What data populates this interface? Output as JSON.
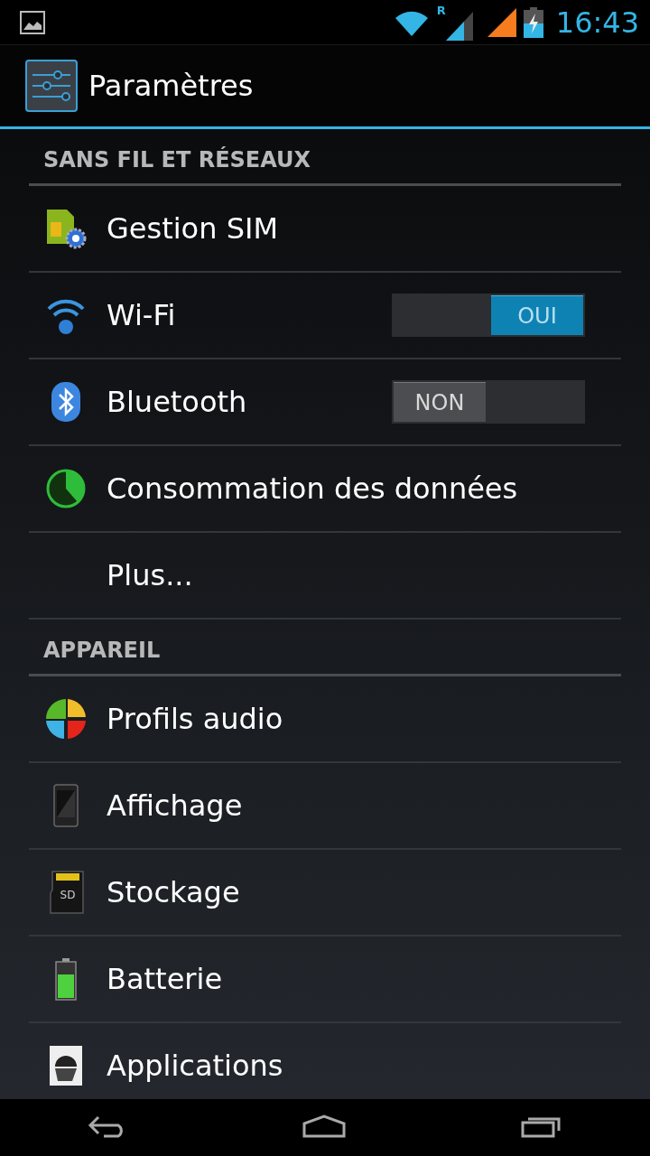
{
  "status_bar": {
    "roaming_label": "R",
    "time": "16:43"
  },
  "action_bar": {
    "title": "Paramètres"
  },
  "sections": [
    {
      "header": "SANS FIL ET RÉSEAUX",
      "items": [
        {
          "kind": "plain",
          "label": "Gestion SIM"
        },
        {
          "kind": "toggle",
          "label": "Wi-Fi",
          "toggle": {
            "on": true,
            "label": "OUI"
          }
        },
        {
          "kind": "toggle",
          "label": "Bluetooth",
          "toggle": {
            "on": false,
            "label": "NON"
          }
        },
        {
          "kind": "plain",
          "label": "Consommation des données"
        },
        {
          "kind": "plain",
          "label": "Plus..."
        }
      ]
    },
    {
      "header": "APPAREIL",
      "items": [
        {
          "kind": "plain",
          "label": "Profils audio"
        },
        {
          "kind": "plain",
          "label": "Affichage"
        },
        {
          "kind": "plain",
          "label": "Stockage",
          "icon_text": "SD"
        },
        {
          "kind": "plain",
          "label": "Batterie"
        },
        {
          "kind": "plain",
          "label": "Applications"
        }
      ]
    }
  ]
}
